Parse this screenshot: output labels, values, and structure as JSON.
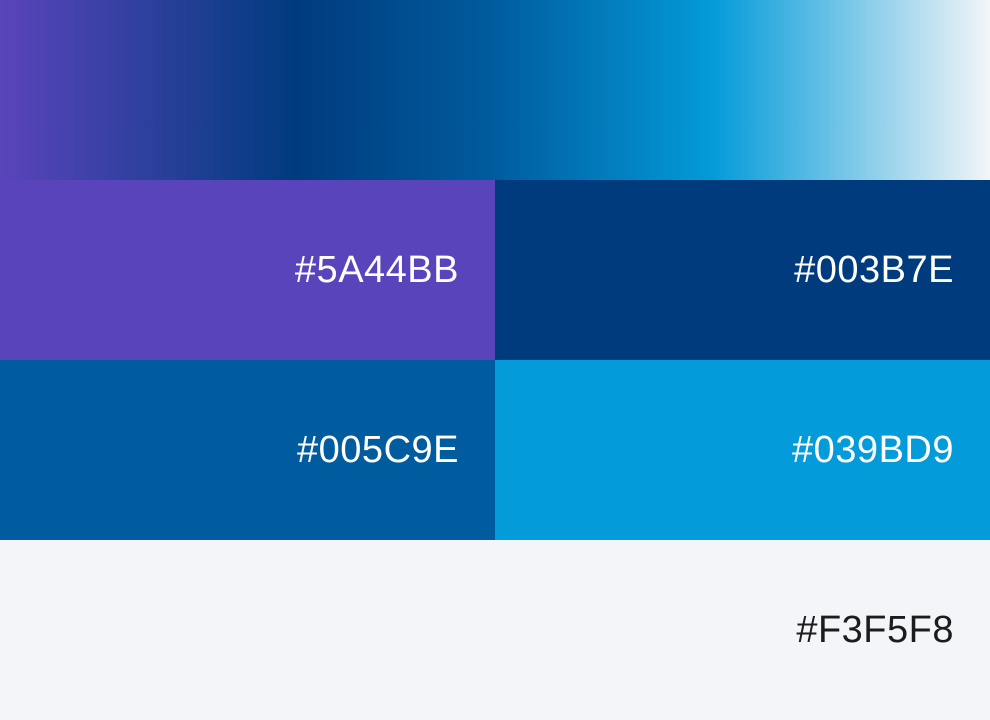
{
  "palette": {
    "gradient_stops": [
      "#5A44BB",
      "#003B7E",
      "#005C9E",
      "#039BD9",
      "#F3F5F8"
    ],
    "swatches": [
      {
        "label": "#5A44BB",
        "color": "#5A44BB",
        "text_color": "#FFFFFF"
      },
      {
        "label": "#003B7E",
        "color": "#003B7E",
        "text_color": "#FFFFFF"
      },
      {
        "label": "#005C9E",
        "color": "#005C9E",
        "text_color": "#FFFFFF"
      },
      {
        "label": "#039BD9",
        "color": "#039BD9",
        "text_color": "#FFFFFF"
      },
      {
        "label": "#F3F5F8",
        "color": "#F3F5F8",
        "text_color": "#1C1C1C"
      }
    ]
  }
}
